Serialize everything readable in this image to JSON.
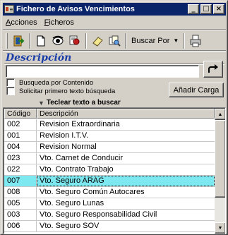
{
  "window": {
    "title": "Fichero de Avisos Vencimientos",
    "minimize_glyph": "_",
    "maximize_glyph": "□",
    "close_glyph": "×"
  },
  "menu": {
    "items": [
      {
        "label": "Acciones"
      },
      {
        "label": "Ficheros"
      }
    ]
  },
  "toolbar": {
    "icons": [
      "exit-door-icon",
      "new-document-icon",
      "view-eye-icon",
      "print-preview-icon",
      "eraser-icon",
      "search-docs-icon"
    ],
    "search_by_label": "Buscar Por",
    "printer_icon": "printer-icon"
  },
  "search": {
    "section_label": "Descripción",
    "input_value": "",
    "option_content": "Busqueda por Contenido",
    "option_first_text": "Solicitar primero texto búsqueda",
    "add_button": "Añadir Carga",
    "hint": "Teclear texto a buscar"
  },
  "table": {
    "columns": [
      "Código",
      "Descripción"
    ],
    "rows": [
      {
        "code": "002",
        "desc": "Revision Extraordinaria",
        "selected": false
      },
      {
        "code": "001",
        "desc": "Revision I.T.V.",
        "selected": false
      },
      {
        "code": "004",
        "desc": "Revision Normal",
        "selected": false
      },
      {
        "code": "023",
        "desc": "Vto. Carnet de Conducir",
        "selected": false
      },
      {
        "code": "022",
        "desc": "Vto. Contrato Trabajo",
        "selected": false
      },
      {
        "code": "007",
        "desc": "Vto. Seguro ARAG",
        "selected": true
      },
      {
        "code": "008",
        "desc": "Vto. Seguro Común Autocares",
        "selected": false
      },
      {
        "code": "005",
        "desc": "Vto. Seguro Lunas",
        "selected": false
      },
      {
        "code": "003",
        "desc": "Vto. Seguro Responsabilidad Civil",
        "selected": false
      },
      {
        "code": "006",
        "desc": "Vto. Seguro SOV",
        "selected": false
      }
    ]
  },
  "colors": {
    "titlebar": "#0a246a",
    "section_label": "#1c3fa8",
    "selected_row": "#7ee8f0",
    "face": "#d4d0c8"
  }
}
